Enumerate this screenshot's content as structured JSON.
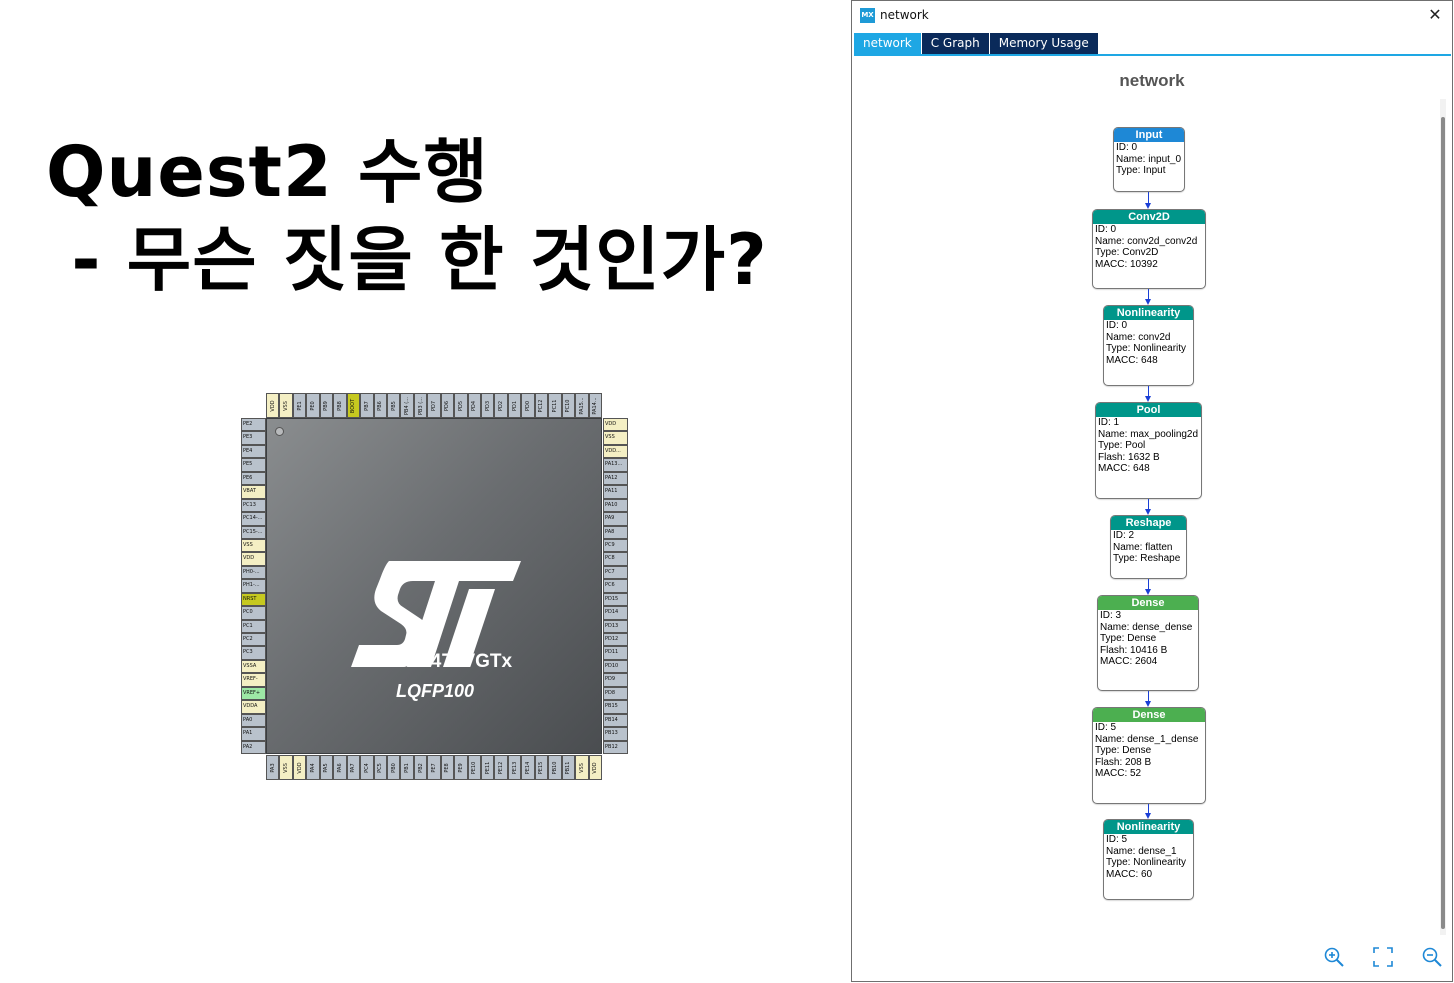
{
  "slide": {
    "title_line1": "Quest2 수행",
    "title_line2": " - 무슨 짓을 한 것인가?"
  },
  "chip": {
    "name": "STM32L475VGTx",
    "package": "LQFP100",
    "pins_top": [
      "VDD",
      "VSS",
      "PE1",
      "PE0",
      "PB9",
      "PB8",
      "BOOT",
      "PB7",
      "PB6",
      "PB5",
      "PB4 (...",
      "PB3 (...",
      "PD7",
      "PD6",
      "PD5",
      "PD4",
      "PD3",
      "PD2",
      "PD1",
      "PD0",
      "PC12",
      "PC11",
      "PC10",
      "PA15...",
      "PA14..."
    ],
    "pins_right": [
      "VDD",
      "VSS",
      "VDD...",
      "PA13...",
      "PA12",
      "PA11",
      "PA10",
      "PA9",
      "PA8",
      "PC9",
      "PC8",
      "PC7",
      "PC6",
      "PD15",
      "PD14",
      "PD13",
      "PD12",
      "PD11",
      "PD10",
      "PD9",
      "PD8",
      "PB15",
      "PB14",
      "PB13",
      "PB12"
    ],
    "pins_left": [
      "PE2",
      "PE3",
      "PE4",
      "PE5",
      "PE6",
      "VBAT",
      "PC13",
      "PC14-...",
      "PC15-...",
      "VSS",
      "VDD",
      "PH0-...",
      "PH1-...",
      "NRST",
      "PC0",
      "PC1",
      "PC2",
      "PC3",
      "VSSA",
      "VREF-",
      "VREF+",
      "VDDA",
      "PA0",
      "PA1",
      "PA2"
    ],
    "pins_bottom": [
      "PA3",
      "VSS",
      "VDD",
      "PA4",
      "PA5",
      "PA6",
      "PA7",
      "PC4",
      "PC5",
      "PB0",
      "PB1",
      "PB2",
      "PE7",
      "PE8",
      "PE9",
      "PE10",
      "PE11",
      "PE12",
      "PE13",
      "PE14",
      "PE15",
      "PB10",
      "PB11",
      "VSS",
      "VDD"
    ]
  },
  "window": {
    "icon_label": "MX",
    "title": "network",
    "close_label": "✕",
    "tabs": [
      "network",
      "C Graph",
      "Memory Usage"
    ],
    "graph_title": "network"
  },
  "nodes": [
    {
      "head": "Input",
      "color": "#1e88d6",
      "lines": [
        "ID: 0",
        "Name: input_0",
        "Type: Input"
      ]
    },
    {
      "head": "Conv2D",
      "color": "#00968a",
      "lines": [
        "ID: 0",
        "Name: conv2d_conv2d",
        "Type: Conv2D",
        "MACC: 10392"
      ]
    },
    {
      "head": "Nonlinearity",
      "color": "#00968a",
      "lines": [
        "ID: 0",
        "Name: conv2d",
        "Type: Nonlinearity",
        "MACC: 648"
      ]
    },
    {
      "head": "Pool",
      "color": "#00968a",
      "lines": [
        "ID: 1",
        "Name: max_pooling2d",
        "Type: Pool",
        "Flash: 1632 B",
        "MACC: 648"
      ]
    },
    {
      "head": "Reshape",
      "color": "#00968a",
      "lines": [
        "ID: 2",
        "Name: flatten",
        "Type: Reshape"
      ]
    },
    {
      "head": "Dense",
      "color": "#4caf50",
      "lines": [
        "ID: 3",
        "Name: dense_dense",
        "Type: Dense",
        "Flash: 10416 B",
        "MACC: 2604"
      ]
    },
    {
      "head": "Dense",
      "color": "#4caf50",
      "lines": [
        "ID: 5",
        "Name: dense_1_dense",
        "Type: Dense",
        "Flash: 208 B",
        "MACC: 52"
      ]
    },
    {
      "head": "Nonlinearity",
      "color": "#00968a",
      "lines": [
        "ID: 5",
        "Name: dense_1",
        "Type: Nonlinearity",
        "MACC: 60"
      ]
    }
  ],
  "zoom_controls": [
    "zoom-in-icon",
    "fit-screen-icon",
    "zoom-out-icon"
  ]
}
